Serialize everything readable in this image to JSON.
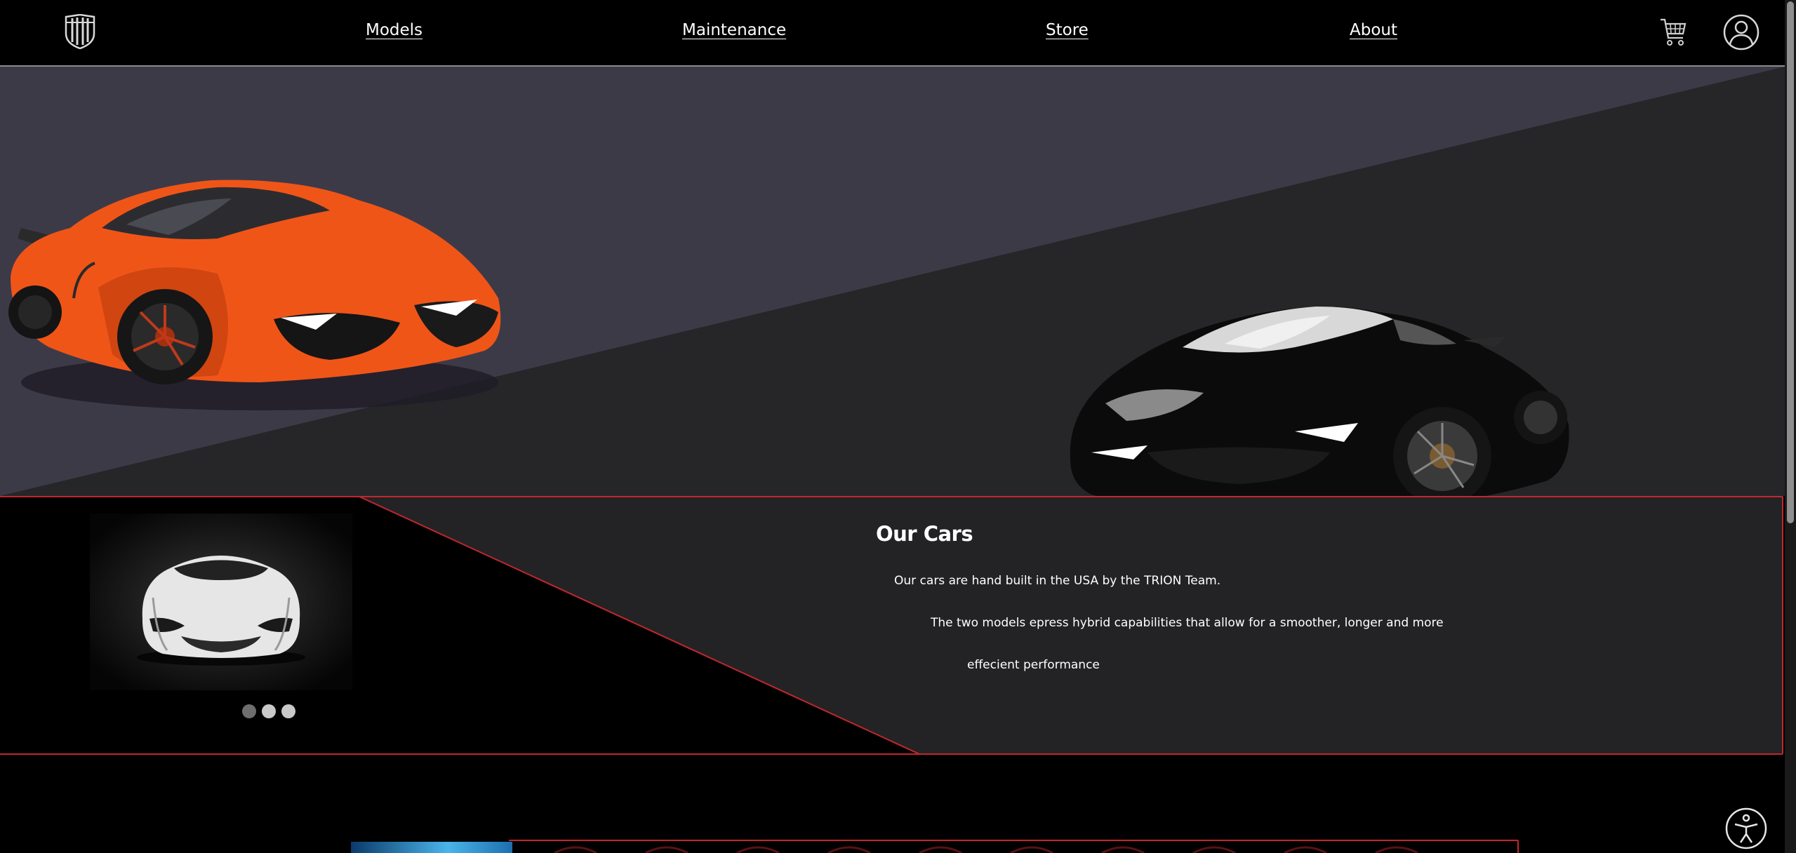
{
  "header": {
    "nav": [
      {
        "label": "Models"
      },
      {
        "label": "Maintenance"
      },
      {
        "label": "Store"
      },
      {
        "label": "About"
      }
    ],
    "icons": [
      "shield-logo-icon",
      "shopping-cart-icon",
      "user-account-icon"
    ]
  },
  "hero": {
    "images": [
      "orange-supercar",
      "black-supercar"
    ]
  },
  "our_cars": {
    "title": "Our Cars",
    "line1": "Our cars are hand built in the USA by the TRION Team.",
    "line2": "The two models epress hybrid capabilities that allow for a smoother, longer and more",
    "line3": "effecient performance",
    "carousel_dots": 3
  },
  "accessibility": {
    "icon": "accessibility-person-icon"
  },
  "colors": {
    "background": "#000000",
    "hero_light": "#3d3a48",
    "hero_dark": "#262628",
    "section_bg": "#232325",
    "accent_red": "#c1272d"
  }
}
